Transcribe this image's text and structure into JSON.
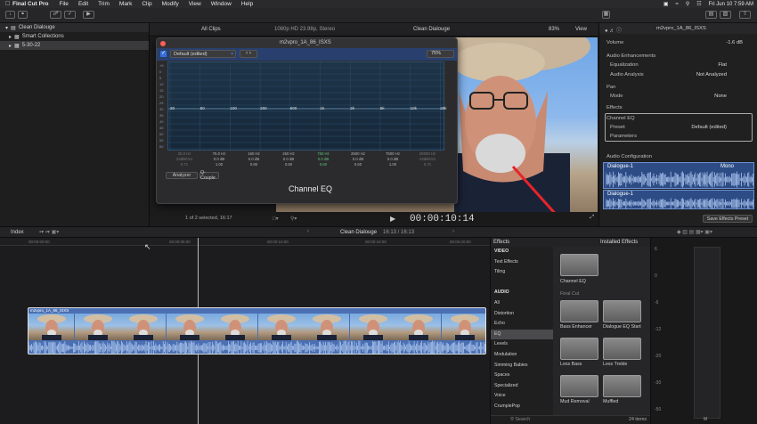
{
  "menubar": {
    "app": "Final Cut Pro",
    "items": [
      "File",
      "Edit",
      "Trim",
      "Mark",
      "Clip",
      "Modify",
      "View",
      "Window",
      "Help"
    ],
    "clock": "Fri Jun 10  7:59 AM"
  },
  "library": {
    "root": "Clean Dialouge",
    "items": [
      "Smart Collections",
      "5-30-22"
    ]
  },
  "viewer": {
    "filter": "All Clips",
    "format": "1080p HD 23.98p, Stereo",
    "title": "Clean Dialouge",
    "zoom": "83%",
    "view_label": "View",
    "selection_info": "1 of 2 selected, 16:17",
    "timecode": "00:00:10:14"
  },
  "eq": {
    "window_title": "m2vpro_1A_86_ISXS",
    "preset": "Default (edited)",
    "zoom": "75%",
    "plugin_name": "Channel EQ",
    "analyzer_btn": "Analyzer",
    "couple_btn": "Q-Couple",
    "db_scale": [
      "+6",
      "0",
      "5",
      "10",
      "15",
      "20",
      "25",
      "30",
      "35",
      "40",
      "45",
      "50",
      "55",
      "60"
    ],
    "freq_marks": [
      "20",
      "50",
      "100",
      "200",
      "500",
      "1k",
      "2k",
      "5k",
      "10k",
      "20k"
    ],
    "bands": [
      {
        "freq": "20.0 Hz",
        "gain": "24dB/Oct",
        "q": "0.71"
      },
      {
        "freq": "75.0 Hz",
        "gain": "0.0 dB",
        "q": "1.00"
      },
      {
        "freq": "160 Hz",
        "gain": "0.0 dB",
        "q": "0.80"
      },
      {
        "freq": "250 Hz",
        "gain": "0.0 dB",
        "q": "0.60"
      },
      {
        "freq": "750 Hz",
        "gain": "0.0 dB",
        "q": "0.60"
      },
      {
        "freq": "2500 Hz",
        "gain": "0.0 dB",
        "q": "0.60"
      },
      {
        "freq": "7500 Hz",
        "gain": "0.0 dB",
        "q": "1.00"
      },
      {
        "freq": "20000 Hz",
        "gain": "24dB/Oct",
        "q": "0.71"
      }
    ]
  },
  "inspector": {
    "clip_name": "m2vpro_1A_86_ISXS",
    "volume_label": "Volume",
    "volume_value": "-1.6 dB",
    "enhancements_label": "Audio Enhancements",
    "equalization_label": "Equalization",
    "equalization_value": "Flat",
    "analysis_label": "Audio Analysis",
    "analysis_value": "Not Analyzed",
    "pan_label": "Pan",
    "mode_label": "Mode",
    "mode_value": "None",
    "effects_label": "Effects",
    "effect_name": "Channel EQ",
    "preset_label": "Preset",
    "preset_value": "Default (edited)",
    "parameters_label": "Parameters",
    "config_label": "Audio Configuration",
    "track1_name": "Dialogue-1",
    "track1_mode": "Mono",
    "track2_name": "Dialogue-1",
    "save_btn": "Save Effects Preset"
  },
  "timeline": {
    "index_label": "Index",
    "project": "Clean Dialouge",
    "duration": "16:13 / 16:13",
    "ruler": [
      "00:00:00:00",
      "00:00:05:00",
      "00:00:10:00",
      "00:00:15:00",
      "00:00:20:00"
    ],
    "clip_label": "m2vpro_1A_86_ISXS"
  },
  "effects": {
    "title": "Effects",
    "installed": "Installed Effects",
    "categories": [
      {
        "label": "VIDEO",
        "head": true
      },
      {
        "label": "Text Effects"
      },
      {
        "label": "Tiling"
      },
      {
        "label": ""
      },
      {
        "label": "AUDIO",
        "head": true
      },
      {
        "label": "All"
      },
      {
        "label": "Distortion"
      },
      {
        "label": "Echo"
      },
      {
        "label": "EQ",
        "selected": true
      },
      {
        "label": "Levels"
      },
      {
        "label": "Modulation"
      },
      {
        "label": "Simming Babies"
      },
      {
        "label": "Spaces"
      },
      {
        "label": "Specialized"
      },
      {
        "label": "Voice"
      },
      {
        "label": "CrumplePop"
      }
    ],
    "group_label": "Final Cut",
    "featured": "Channel EQ",
    "items": [
      "Bass Enhancer",
      "Dialogue EQ Start",
      "Less Bass",
      "Less Treble",
      "Mud Removal",
      "Muffled"
    ],
    "count": "24 items",
    "search_placeholder": "Search"
  },
  "meter": {
    "scale": [
      "6",
      "0",
      "-6",
      "-12",
      "-20",
      "-30",
      "-50"
    ],
    "channel": "M"
  },
  "colors": {
    "accent": "#3a6fd8",
    "clip": "#4a6fb3",
    "arrow": "#e8242a"
  }
}
